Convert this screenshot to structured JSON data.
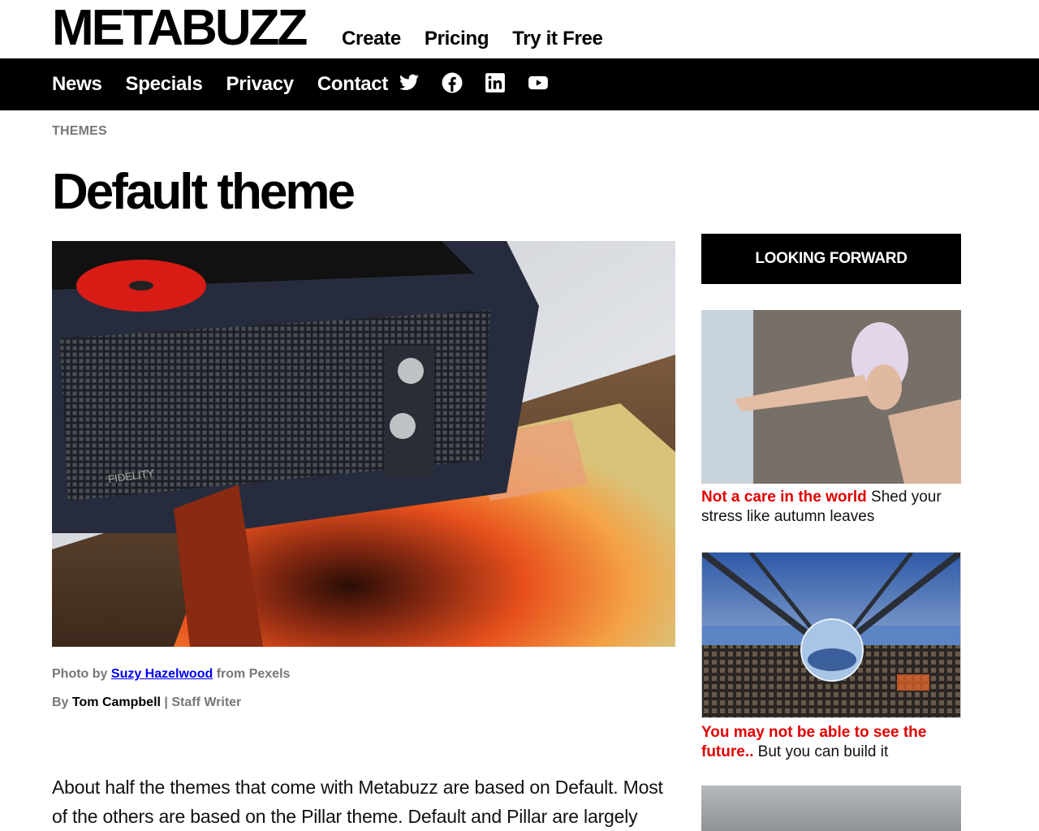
{
  "brand": {
    "logo": "METABUZZ"
  },
  "top_nav": [
    "Create",
    "Pricing",
    "Try it Free"
  ],
  "main_nav": [
    "News",
    "Specials",
    "Privacy",
    "Contact"
  ],
  "social_icons": [
    "twitter-icon",
    "facebook-icon",
    "linkedin-icon",
    "youtube-icon"
  ],
  "article": {
    "category": "THEMES",
    "title": "Default theme",
    "caption": {
      "prefix": "Photo by",
      "link": "Suzy Hazelwood",
      "suffix": "from Pexels"
    },
    "byline": {
      "prefix": "By",
      "author": "Tom Campbell",
      "separator": "|",
      "role": "Staff Writer"
    },
    "body": "About half the themes that come with Metabuzz are based on Default. Most of the others are based on the Pillar theme. Default and Pillar are largely"
  },
  "sidebar": {
    "heading": "LOOKING FORWARD",
    "cards": [
      {
        "highlight": "Not a care in the world",
        "text": "Shed your stress like autumn leaves"
      },
      {
        "highlight": "You may not be able to see the future..",
        "text": "But you can build it"
      }
    ]
  },
  "colors": {
    "accent_red": "#e00000",
    "nav_bg": "#000000",
    "link_blue": "#0000ee"
  }
}
